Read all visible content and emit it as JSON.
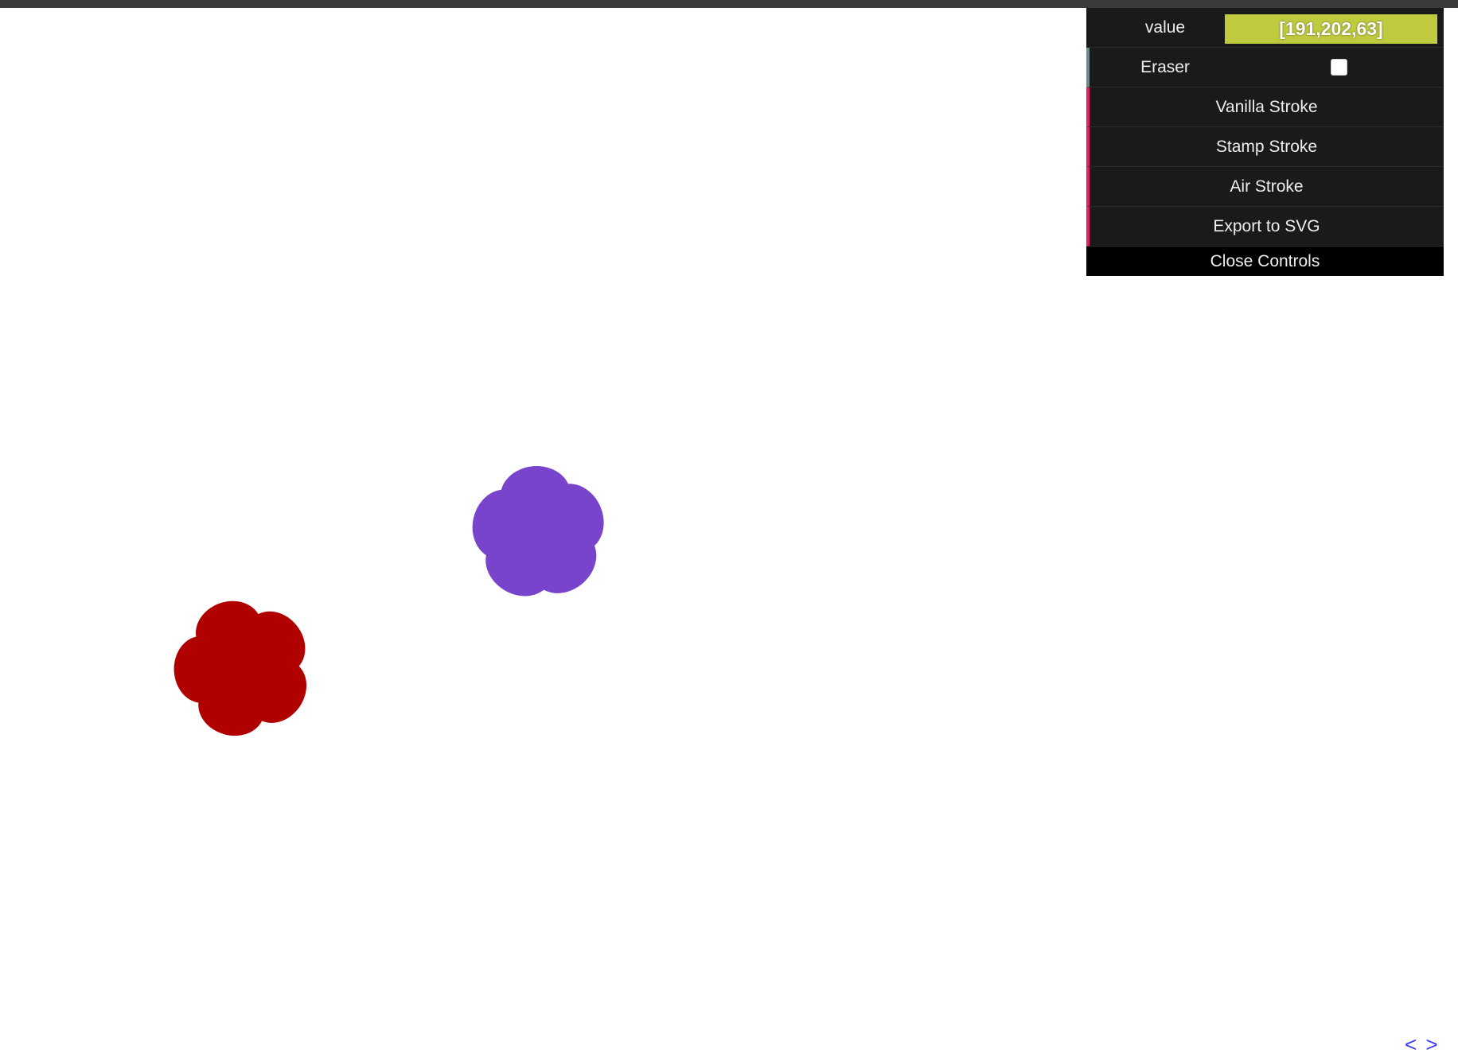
{
  "controls": {
    "color": {
      "label": "value",
      "value": "[191,202,63]",
      "swatch_color": "#bfca3f"
    },
    "eraser": {
      "label": "Eraser",
      "checked": false
    },
    "buttons": {
      "vanilla": "Vanilla Stroke",
      "stamp": "Stamp Stroke",
      "air": "Air Stroke",
      "export": "Export to SVG"
    },
    "close_label": "Close Controls"
  },
  "canvas": {
    "shapes": [
      {
        "name": "purple-flower-shape",
        "color": "#7844cc"
      },
      {
        "name": "red-flower-shape",
        "color": "#b00000"
      }
    ]
  },
  "nav": {
    "prev": "<",
    "next": ">"
  }
}
